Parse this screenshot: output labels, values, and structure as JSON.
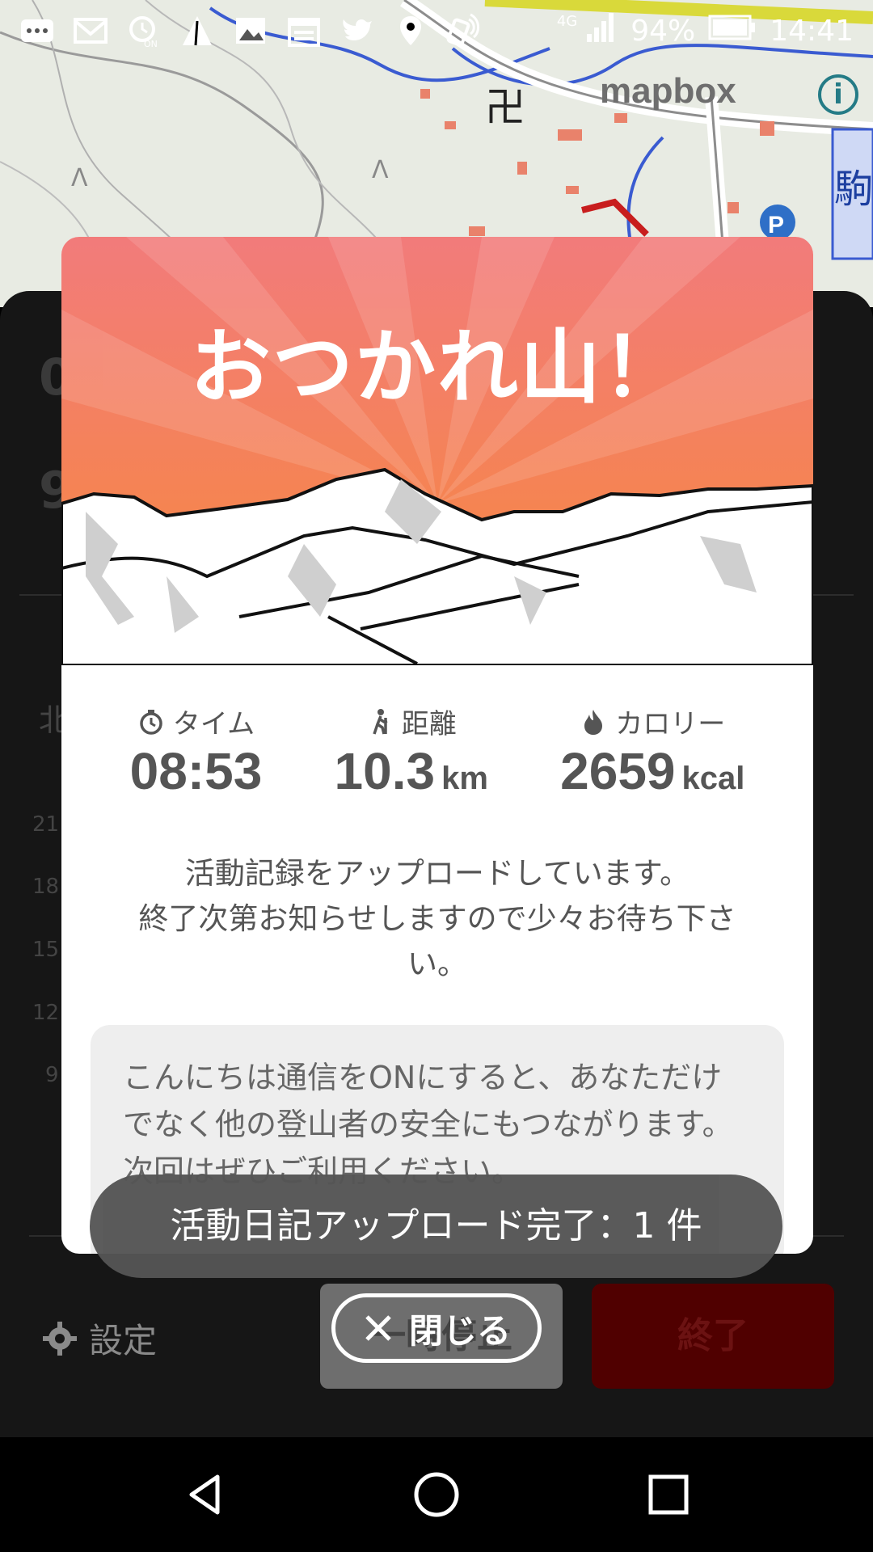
{
  "status_bar": {
    "battery": "94%",
    "time": "14:41",
    "network": "4G",
    "icons": [
      "message-icon",
      "gmail-icon",
      "timer-on-icon",
      "mountain-icon",
      "image-icon",
      "calendar-icon",
      "twitter-icon",
      "location-icon",
      "nfc-icon",
      "signal-icon",
      "battery-icon"
    ]
  },
  "map": {
    "attribution": "mapbox",
    "info": "i",
    "parking": "P",
    "partial_place": "駒"
  },
  "background_sheet": {
    "title_partial": "0",
    "subtitle_partial": "9",
    "north_label": "北",
    "y_ticks": [
      "21",
      "18",
      "15",
      "12",
      "9"
    ],
    "settings_label": "設定",
    "pause_label": "一時停止",
    "end_label": "終了"
  },
  "dialog": {
    "title": "おつかれ山！",
    "stats": [
      {
        "label": "タイム",
        "icon": "stopwatch-icon",
        "value": "08:53",
        "unit": ""
      },
      {
        "label": "距離",
        "icon": "hiker-icon",
        "value": "10.3",
        "unit": "km"
      },
      {
        "label": "カロリー",
        "icon": "flame-icon",
        "value": "2659",
        "unit": "kcal"
      }
    ],
    "upload_line1": "活動記録をアップロードしています。",
    "upload_line2": "終了次第お知らせしますので少々お待ち下さい。",
    "notice_line1": "こんにちは通信をONにすると、あなただけ",
    "notice_line2": "でなく他の登山者の安全にもつながります。",
    "notice_line3": "次回はぜひご利用ください。"
  },
  "toast": {
    "text": "活動日記アップロード完了：1 件"
  },
  "close_button": {
    "label": "閉じる"
  },
  "colors": {
    "hero_top": "#f27a7a",
    "hero_bottom": "#f58a3c",
    "end_button": "#500000"
  }
}
